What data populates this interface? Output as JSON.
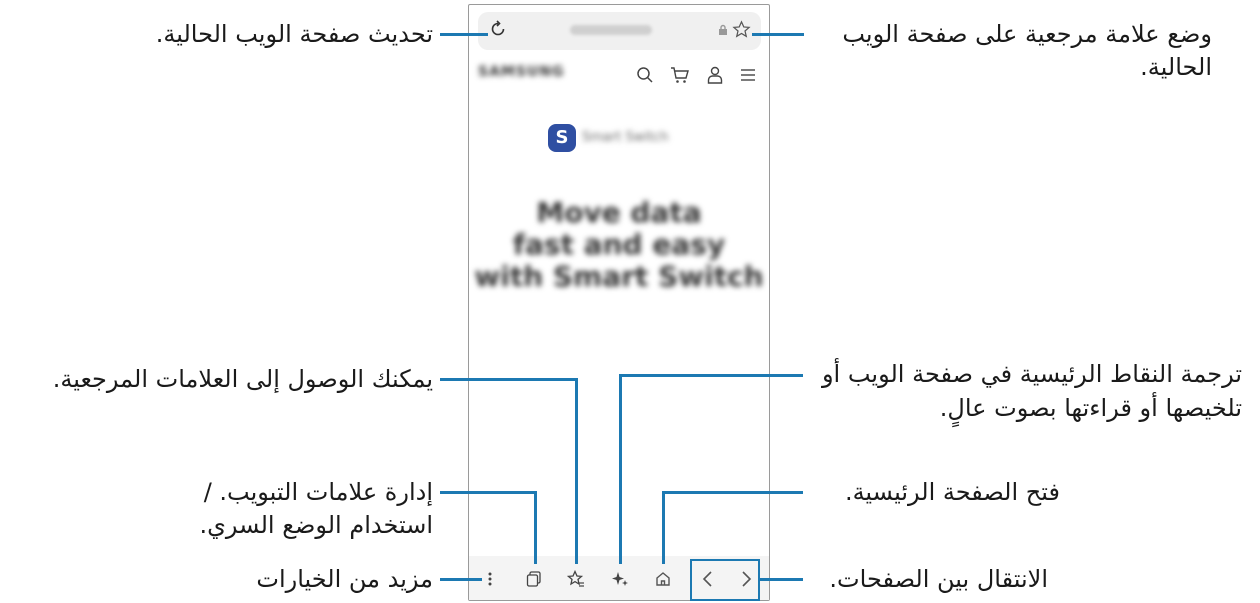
{
  "browser": {
    "site_brand": "SAMSUNG",
    "app_badge_letter": "S",
    "app_name": "Smart Switch",
    "hero_line1": "Move data",
    "hero_line2": "fast and easy",
    "hero_line3": "with Smart Switch"
  },
  "annotations": {
    "refresh": "تحديث صفحة الويب الحالية.",
    "bookmark_line1": "وضع علامة مرجعية على صفحة الويب",
    "bookmark_line2": "الحالية.",
    "bookmarks_access": "يمكنك الوصول إلى العلامات المرجعية.",
    "ai_line1": "ترجمة النقاط الرئيسية في صفحة الويب أو",
    "ai_line2": "تلخيصها أو قراءتها بصوت عالٍ.",
    "tabs_line1": "إدارة علامات التبويب. /",
    "tabs_line2": "استخدام الوضع السري.",
    "home": "فتح الصفحة الرئيسية.",
    "more": "مزيد من الخيارات",
    "navigate": "الانتقال بين الصفحات."
  },
  "colors": {
    "callout_line": "#1c79b2",
    "badge": "#2f4fa2"
  }
}
